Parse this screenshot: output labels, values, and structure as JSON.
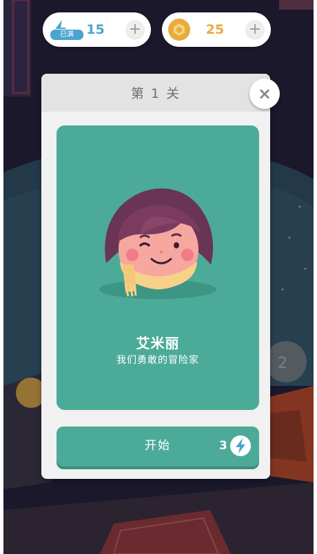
{
  "status_bar": {
    "energy": {
      "value": "15",
      "status": "已满",
      "icon": "lightning-icon",
      "color": "#4aa4cf"
    },
    "coins": {
      "value": "25",
      "icon": "hex-coin-icon",
      "color": "#e9ab3f"
    },
    "plus_symbol": "+"
  },
  "modal": {
    "title": "第 1 关",
    "close_symbol": "×",
    "character": {
      "name": "艾米丽",
      "description": "我们勇敢的冒险家"
    },
    "start_button": {
      "label": "开始",
      "cost": "3",
      "cost_icon": "lightning-icon"
    }
  },
  "colors": {
    "card": "#4bab98",
    "background": "#26213a"
  }
}
